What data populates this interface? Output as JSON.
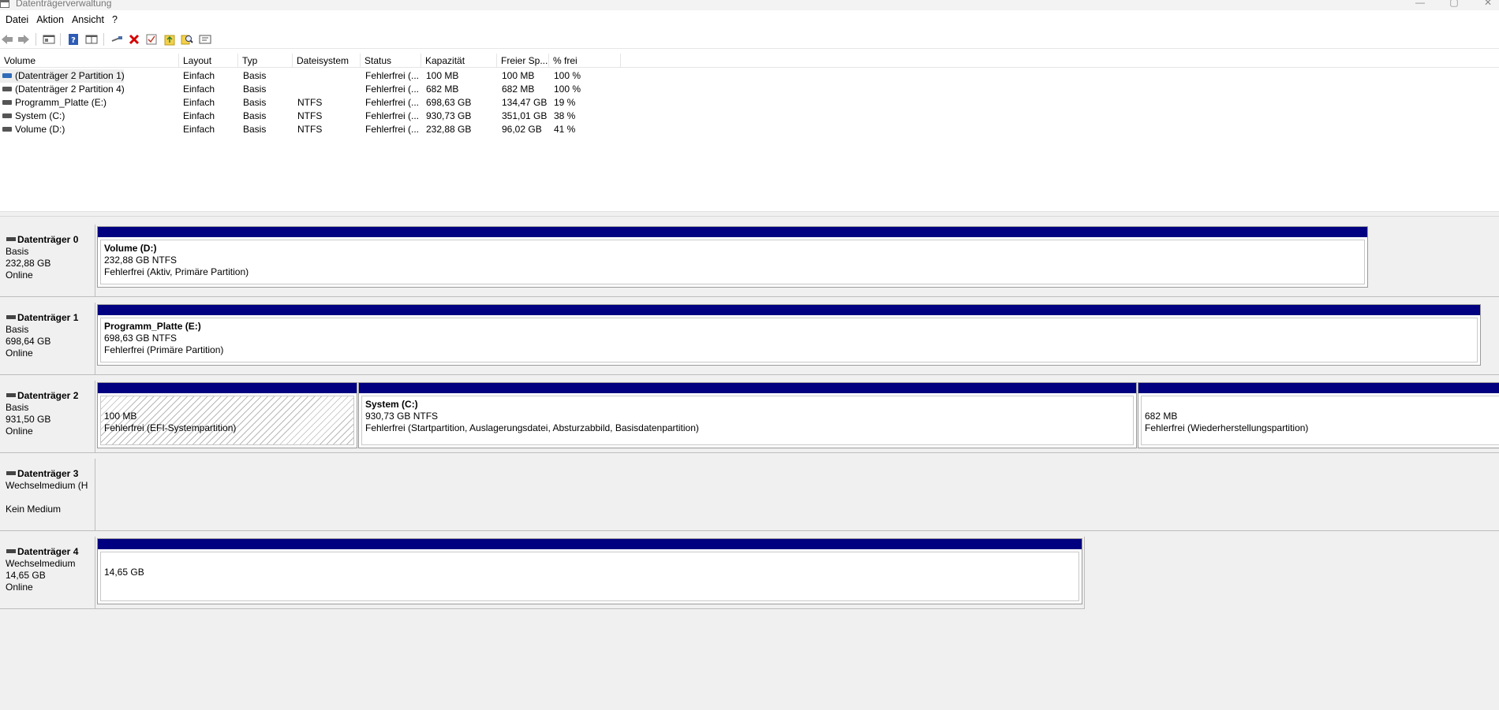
{
  "window": {
    "title": "Datenträgerverwaltung"
  },
  "menu": {
    "items": [
      "Datei",
      "Aktion",
      "Ansicht",
      "?"
    ]
  },
  "toolbar": {
    "buttons": [
      "back-arrow-icon",
      "forward-arrow-icon",
      "console-tree-icon",
      "help-icon",
      "details-pane-icon",
      "connect-drive-icon",
      "delete-icon",
      "properties-icon",
      "import-icon",
      "search-icon",
      "more-actions-icon"
    ]
  },
  "volume_list": {
    "columns": [
      "Volume",
      "Layout",
      "Typ",
      "Dateisystem",
      "Status",
      "Kapazität",
      "Freier Sp...",
      "% frei"
    ],
    "rows": [
      {
        "volume": "(Datenträger 2 Partition 1)",
        "layout": "Einfach",
        "typ": "Basis",
        "fs": "",
        "status": "Fehlerfrei (...",
        "capacity": "100 MB",
        "free": "100 MB",
        "pct": "100 %"
      },
      {
        "volume": "(Datenträger 2 Partition 4)",
        "layout": "Einfach",
        "typ": "Basis",
        "fs": "",
        "status": "Fehlerfrei (...",
        "capacity": "682 MB",
        "free": "682 MB",
        "pct": "100 %"
      },
      {
        "volume": "Programm_Platte (E:)",
        "layout": "Einfach",
        "typ": "Basis",
        "fs": "NTFS",
        "status": "Fehlerfrei (...",
        "capacity": "698,63 GB",
        "free": "134,47 GB",
        "pct": "19 %"
      },
      {
        "volume": "System (C:)",
        "layout": "Einfach",
        "typ": "Basis",
        "fs": "NTFS",
        "status": "Fehlerfrei (...",
        "capacity": "930,73 GB",
        "free": "351,01 GB",
        "pct": "38 %"
      },
      {
        "volume": "Volume (D:)",
        "layout": "Einfach",
        "typ": "Basis",
        "fs": "NTFS",
        "status": "Fehlerfrei (...",
        "capacity": "232,88 GB",
        "free": "96,02 GB",
        "pct": "41 %"
      }
    ]
  },
  "disks": [
    {
      "name": "Datenträger 0",
      "type": "Basis",
      "size": "232,88 GB",
      "state": "Online",
      "partitions": [
        {
          "name": "Volume  (D:)",
          "size": "232,88 GB NTFS",
          "status": "Fehlerfrei (Aktiv, Primäre Partition)"
        }
      ]
    },
    {
      "name": "Datenträger 1",
      "type": "Basis",
      "size": "698,64 GB",
      "state": "Online",
      "partitions": [
        {
          "name": "Programm_Platte  (E:)",
          "size": "698,63 GB NTFS",
          "status": "Fehlerfrei (Primäre Partition)"
        }
      ]
    },
    {
      "name": "Datenträger 2",
      "type": "Basis",
      "size": "931,50 GB",
      "state": "Online",
      "partitions": [
        {
          "name": "",
          "size": "100 MB",
          "status": "Fehlerfrei (EFI-Systempartition)"
        },
        {
          "name": "System  (C:)",
          "size": "930,73 GB NTFS",
          "status": "Fehlerfrei (Startpartition, Auslagerungsdatei, Absturzabbild, Basisdatenpartition)"
        },
        {
          "name": "",
          "size": "682 MB",
          "status": "Fehlerfrei (Wiederherstellungspartition)"
        }
      ]
    },
    {
      "name": "Datenträger 3",
      "type": "Wechselmedium (H",
      "size": "",
      "state": "Kein Medium",
      "partitions": []
    },
    {
      "name": "Datenträger 4",
      "type": "Wechselmedium",
      "size": "14,65 GB",
      "state": "Online",
      "partitions": [
        {
          "name": "",
          "size": "14,65 GB",
          "status": ""
        }
      ]
    }
  ]
}
